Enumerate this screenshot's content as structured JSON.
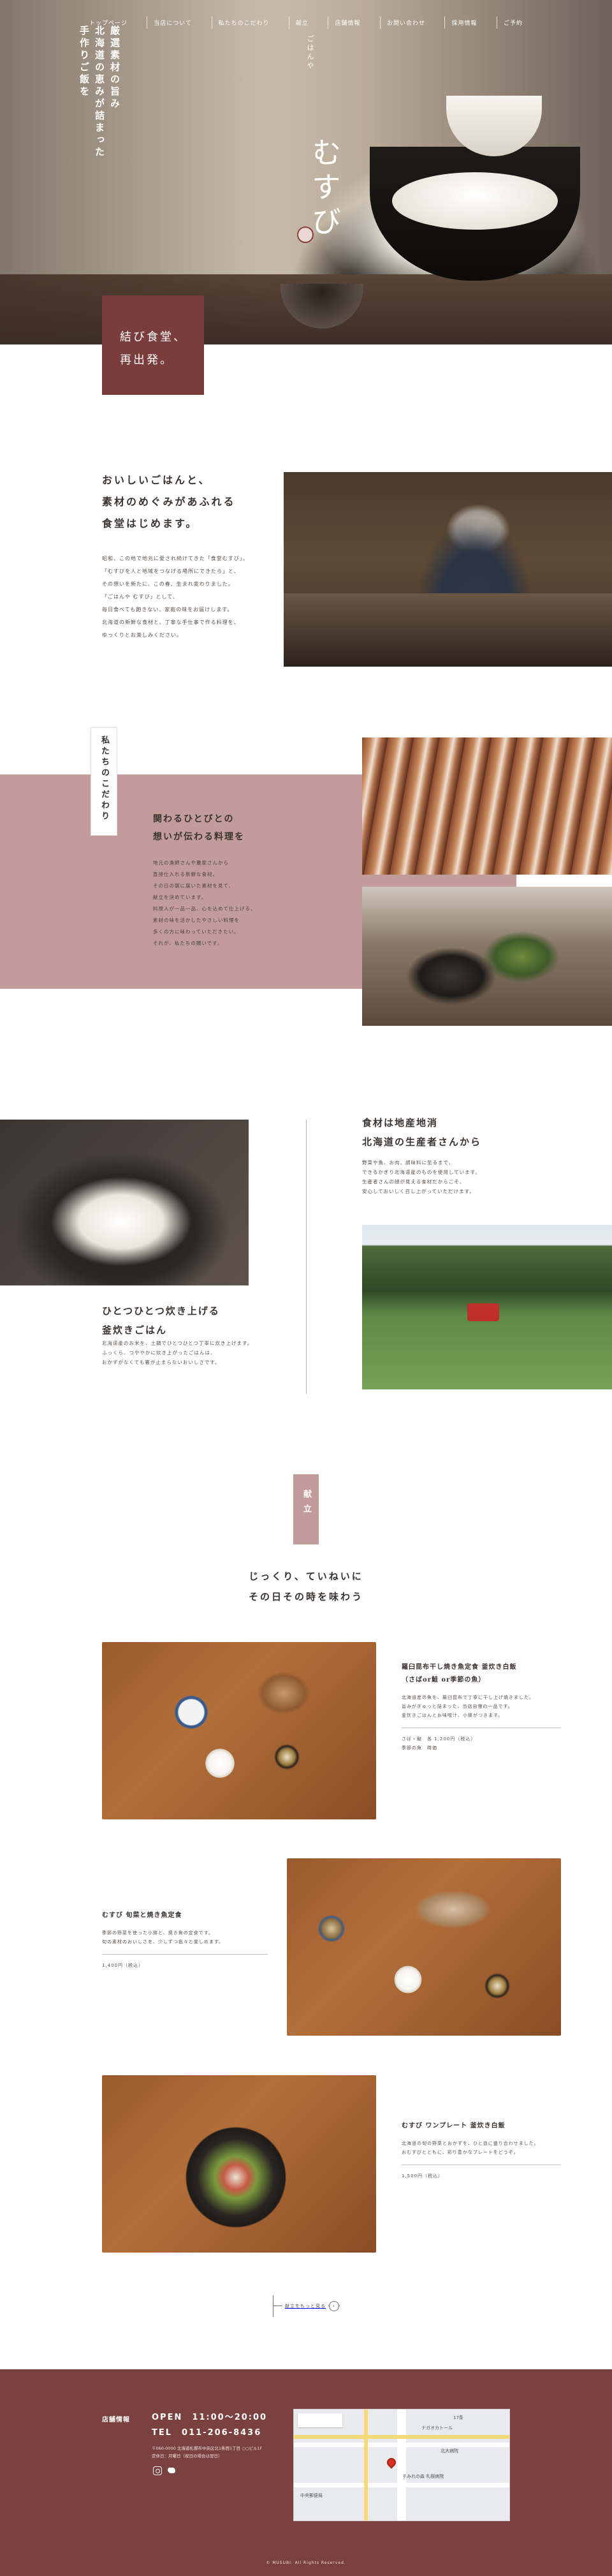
{
  "nav": {
    "items": [
      "トップページ",
      "当店について",
      "私たちのこだわり",
      "献立",
      "店舗情報",
      "お問い合わせ",
      "採用情報",
      "ご予約"
    ]
  },
  "hero": {
    "copy": "厳選素材の旨み\n北海道の恵みが詰まった\n手作りご飯を",
    "logo_furigana": "ごはんや",
    "logo_name": "むすび",
    "tagline": "結び食堂、\n再出発。"
  },
  "intro": {
    "title": "おいしいごはんと、\n素材のめぐみがあふれる\n食堂はじめます。",
    "body": "昭和、この地で地元に愛され続けてきた「食堂むすび」。\n「むすびを人と地域をつなげる場所にできたら」と、\nその想いを新たに、この春、生まれ変わりました。\n「ごはんや むすび」として、\n毎日食べても飽きない、家庭の味をお届けします。\n北海道の新鮮な食材と、丁寧な手仕事で作る料理を、\nゆっくりとお楽しみください。"
  },
  "kodawari": {
    "label": "私たちのこだわり",
    "title": "関わるひとびとの\n想いが伝わる料理を",
    "body": "地元の漁師さんや農家さんから\n直接仕入れる新鮮な食材。\nその日の朝に届いた素材を見て、\n献立を決めています。\n料理人が一品一品、心を込めて仕上げる、\n素材の味を活かしたやさしい料理を\n多くの方に味わっていただきたい。\nそれが、私たちの願いです。"
  },
  "donabe": {
    "title": "ひとつひとつ炊き上げる\n釜炊きごはん",
    "body": "北海道産のお米を、土鍋でひとつひとつ丁寧に炊き上げます。\nふっくら、つややかに炊き上がったごはんは、\nおかずがなくても箸が止まらないおいしさです。"
  },
  "local": {
    "title": "食材は地産地消\n北海道の生産者さんから",
    "body": "野菜や魚、お肉、調味料に至るまで、\nできるかぎり北海道産のものを使用しています。\n生産者さんの顔が見える食材だからこそ、\n安心しておいしく召し上がっていただけます。"
  },
  "kondate": {
    "label": "献立",
    "lead": "じっくり、ていねいに\nその日その時を味わう",
    "menus": [
      {
        "name": "羅臼昆布干し焼き魚定食 釜炊き白飯\n（さばor鮭 or季節の魚）",
        "desc": "北海道産の魚を、羅臼昆布で丁寧に干し上げ焼きました。\n旨みがぎゅっと詰まった、当店自慢の一品です。\n釜炊きごはんとお味噌汁、小鉢がつきます。",
        "price": "さば・鮭　各 1,200円（税込）\n季節の魚　時価"
      },
      {
        "name": "むすび 旬菜と焼き魚定食",
        "desc": "季節の野菜を使った小鉢と、焼き魚の定食です。\n旬の素材のおいしさを、少しずつ色々と楽しめます。",
        "price": "1,400円（税込）"
      },
      {
        "name": "むすび ワンプレート 釜炊き白飯",
        "desc": "北海道の旬の野菜とおかずを、ひと皿に盛り合わせました。\nおむすびとともに、彩り豊かなプレートをどうぞ。",
        "price": "1,500円（税込）"
      }
    ],
    "back_label": "献立をもっと見る",
    "arrow": "›"
  },
  "footer": {
    "title": "店舗情報",
    "hours": "OPEN　11:00〜20:00",
    "tel": "TEL　011-206-8436",
    "address": "〒060-0000 北海道札幌市中央区北1条西1丁目 ○○ビル1F\n定休日：月曜日（祝日の場合は翌日）",
    "map_labels": [
      "17条",
      "ナガオカトール",
      "北大病院",
      "中央郵便局",
      "すみれの森 札幌病院"
    ],
    "copyright": "© MUSUBI. All Rights Reserved."
  },
  "colors": {
    "brand": "#7a3d3b",
    "accent_pink": "#c19c9a",
    "footer_bg": "#7b4140"
  }
}
